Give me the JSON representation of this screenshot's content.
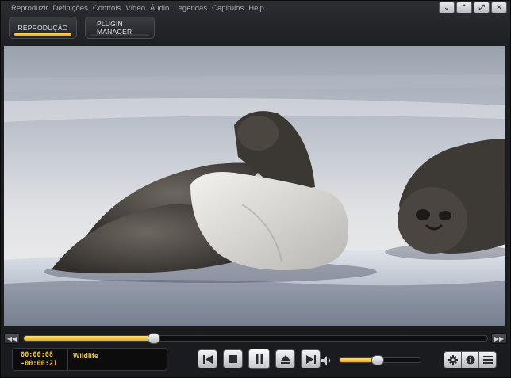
{
  "menu": [
    "Reproduzir",
    "Definições",
    "Controls",
    "Vídeo",
    "Áudio",
    "Legendas",
    "Capítulos",
    "Help"
  ],
  "window_controls": [
    {
      "name": "menu-collapse",
      "glyph": "⌄"
    },
    {
      "name": "minimize",
      "glyph": "⌃"
    },
    {
      "name": "restore",
      "glyph": "⤢"
    },
    {
      "name": "close",
      "glyph": "✕"
    }
  ],
  "tabs": {
    "reproducao": "REPRODUÇÃO",
    "plugin_manager": "PLUGIN MANAGER"
  },
  "playback": {
    "elapsed": "00:00:08",
    "remaining": "-00:00:21",
    "title": "Wildlife",
    "seek_fraction": 0.28,
    "volume_fraction": 0.47
  },
  "seek_arrows": {
    "back": "◀◀",
    "forward": "▶▶"
  },
  "colors": {
    "accent": "#f2c132",
    "background": "#1d1e21"
  },
  "icons": {
    "previous": "skip-back-icon",
    "stop": "stop-icon",
    "pause": "pause-icon",
    "eject": "eject-icon",
    "next": "skip-forward-icon",
    "volume": "speaker-icon",
    "settings": "gear-icon",
    "info": "info-icon",
    "playlist": "list-icon"
  }
}
